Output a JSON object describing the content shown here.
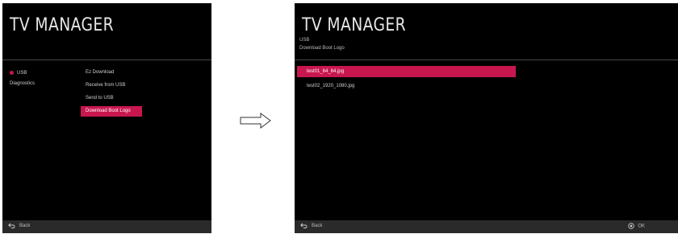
{
  "left_screen": {
    "title": "TV MANAGER",
    "menu": [
      {
        "label": "USB",
        "active": true
      },
      {
        "label": "Diagnostics",
        "active": false
      }
    ],
    "submenu": [
      {
        "label": "Ez Download"
      },
      {
        "label": "Receive from USB"
      },
      {
        "label": "Send to USB"
      },
      {
        "label": "Download Boot Logo",
        "selected": true
      }
    ],
    "footer": {
      "back_label": "Back"
    }
  },
  "right_screen": {
    "title": "TV MANAGER",
    "breadcrumb": [
      "USB",
      "Download Boot Logo"
    ],
    "files": [
      {
        "label": "test01_64_64.jpg",
        "selected": true
      },
      {
        "label": "test02_1920_1080.jpg",
        "selected": false
      }
    ],
    "footer": {
      "back_label": "Back",
      "ok_label": "OK"
    }
  },
  "colors": {
    "accent": "#c8174f",
    "background": "#000000",
    "footer": "#2a2a2a"
  },
  "icons": {
    "arrow": "right-arrow-outline-icon",
    "back": "back-arrow-icon",
    "ok": "ok-button-icon",
    "active_dot": "red-dot-icon"
  }
}
